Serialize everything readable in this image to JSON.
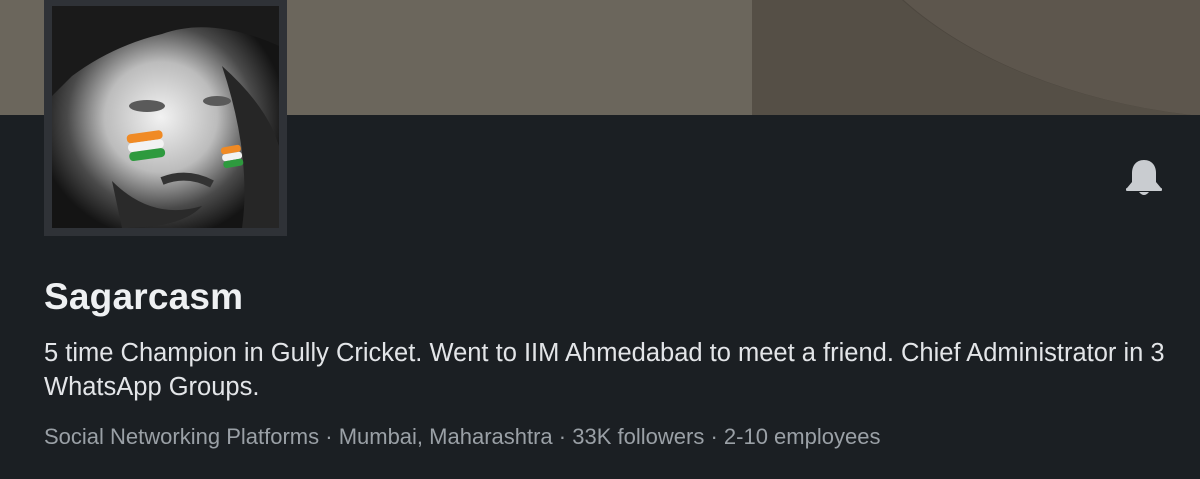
{
  "cover": {
    "colors": {
      "left": "#6b665c",
      "right": "#554f46"
    }
  },
  "company": {
    "name": "Sagarcasm",
    "tagline": "5 time Champion in Gully Cricket. Went to IIM Ahmedabad to meet a friend. Chief Administrator in 3 WhatsApp Groups.",
    "industry": "Social Networking Platforms",
    "location": "Mumbai, Maharashtra",
    "followers": "33K followers",
    "employees": "2-10 employees",
    "separator": "·"
  },
  "icons": {
    "notification": "bell-icon",
    "logo": "profile-photo"
  }
}
